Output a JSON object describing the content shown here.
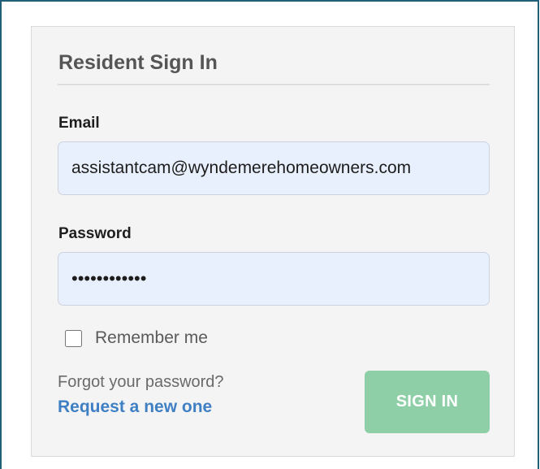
{
  "form": {
    "title": "Resident Sign In",
    "email": {
      "label": "Email",
      "value": "assistantcam@wyndemerehomeowners.com"
    },
    "password": {
      "label": "Password",
      "value": "••••••••••••"
    },
    "remember_me": {
      "label": "Remember me",
      "checked": false
    },
    "forgot": {
      "prompt": "Forgot your password?",
      "link_label": "Request a new one"
    },
    "submit_label": "SIGN IN"
  },
  "colors": {
    "frame_border": "#1f5f78",
    "card_background": "#f4f4f4",
    "input_background": "#e8effd",
    "link": "#3f7fc4",
    "button_background": "#8fcfa7",
    "button_text": "#ffffff"
  }
}
